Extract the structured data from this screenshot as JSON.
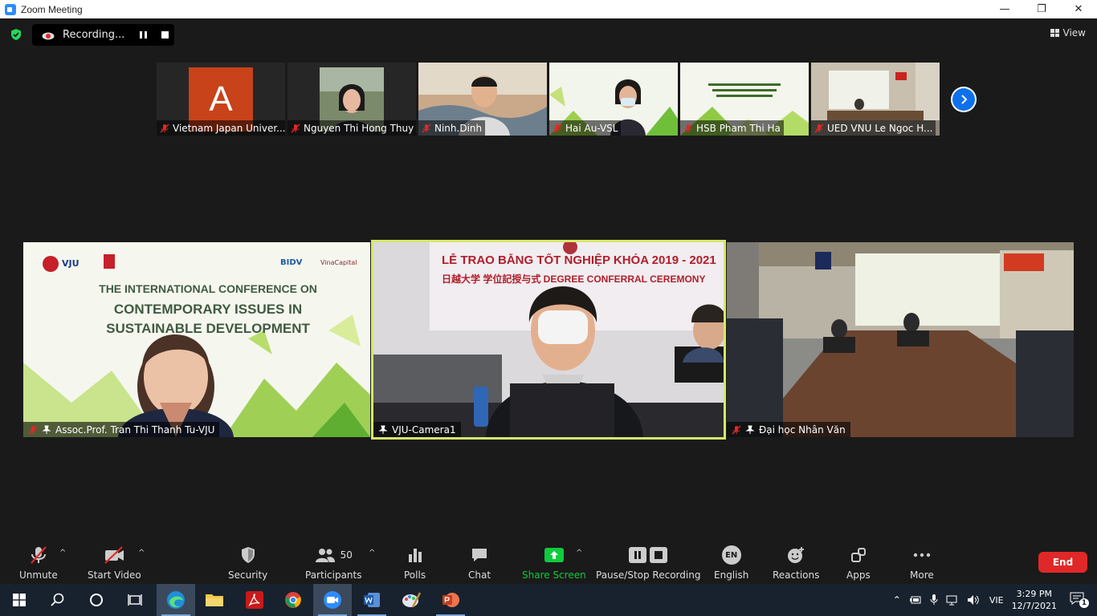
{
  "window": {
    "title": "Zoom Meeting"
  },
  "top_bar": {
    "recording_label": "Recording...",
    "view_label": "View"
  },
  "thumbnails": [
    {
      "name": "Vietnam Japan Univer...",
      "avatar_letter": "A"
    },
    {
      "name": "Nguyen Thi Hong Thuy"
    },
    {
      "name": "Ninh.Dinh"
    },
    {
      "name": "Hai Au-VSL"
    },
    {
      "name": "HSB Pham Thi Ha"
    },
    {
      "name": "UED VNU Le Ngoc H..."
    }
  ],
  "tiles": [
    {
      "name": "Assoc.Prof. Tran Thi Thanh Tu-VJU",
      "banner": [
        "THE INTERNATIONAL CONFERENCE ON",
        "CONTEMPORARY ISSUES IN",
        "SUSTAINABLE DEVELOPMENT"
      ],
      "logos": [
        "VJU",
        "BIDV",
        "VinaCapital"
      ]
    },
    {
      "name": "VJU-Camera1",
      "banner": [
        "LỄ TRAO BẰNG TỐT NGHIỆP KHÓA 2019 - 2021",
        "日越大学  学位記授与式  DEGREE CONFERRAL CEREMONY"
      ]
    },
    {
      "name": "Đại học Nhân Văn"
    }
  ],
  "toolbar": {
    "unmute": "Unmute",
    "start_video": "Start Video",
    "security": "Security",
    "participants": "Participants",
    "participants_count": "50",
    "polls": "Polls",
    "chat": "Chat",
    "share_screen": "Share Screen",
    "pause_stop_recording": "Pause/Stop Recording",
    "language_code": "EN",
    "english": "English",
    "reactions": "Reactions",
    "apps": "Apps",
    "more": "More",
    "end": "End"
  },
  "taskbar": {
    "language": "VIE",
    "time": "3:29 PM",
    "date": "12/7/2021",
    "notifications": "1"
  },
  "colors": {
    "share_green": "#0ecc3c",
    "end_red": "#e02828",
    "active_speaker": "#d6e86a",
    "zoom_blue": "#0e71eb"
  }
}
